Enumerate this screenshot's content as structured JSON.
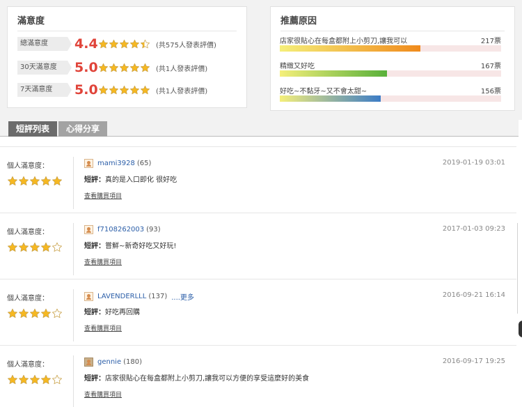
{
  "satisfaction": {
    "title": "滿意度",
    "rows": [
      {
        "label": "總滿意度",
        "score": "4.4",
        "rating": 4.4,
        "count": "(共575人發表評價)"
      },
      {
        "label": "30天滿意度",
        "score": "5.0",
        "rating": 5,
        "count": "(共1人發表評價)"
      },
      {
        "label": "7天滿意度",
        "score": "5.0",
        "rating": 5,
        "count": "(共1人發表評價)"
      }
    ]
  },
  "reasons": {
    "title": "推薦原因",
    "items": [
      {
        "text": "店家很貼心在每盒都附上小剪刀,讓我可以",
        "votes": "217票",
        "fill": 0.635,
        "color": "#f08a1c"
      },
      {
        "text": "精緻又好吃",
        "votes": "167票",
        "fill": 0.485,
        "color": "#58b03a"
      },
      {
        "text": "好吃~不黏牙~又不會太甜~",
        "votes": "156票",
        "fill": 0.455,
        "color": "#3c7cc6"
      }
    ]
  },
  "tabs": [
    {
      "label": "短評列表"
    },
    {
      "label": "心得分享"
    }
  ],
  "reviews": [
    {
      "label": "個人滿意度：",
      "rating": 5,
      "user": "mami3928",
      "level": "(65)",
      "more": "",
      "date": "2019-01-19 03:01",
      "prefix": "短評：",
      "text": "真的是入口即化 很好吃",
      "link": "查看購買項目",
      "avatar": "default"
    },
    {
      "label": "個人滿意度：",
      "rating": 4,
      "user": "f7108262003",
      "level": "(93)",
      "more": "",
      "date": "2017-01-03 09:23",
      "prefix": "短評：",
      "text": "嘗鮮~新奇好吃又好玩!",
      "link": "查看購買項目",
      "avatar": "default"
    },
    {
      "label": "個人滿意度：",
      "rating": 4,
      "user": "LAVENDERLLL",
      "level": "(137)",
      "more": "....更多",
      "date": "2016-09-21 16:14",
      "prefix": "短評：",
      "text": "好吃再回購",
      "link": "查看購買項目",
      "avatar": "default"
    },
    {
      "label": "個人滿意度：",
      "rating": 4,
      "user": "gennie",
      "level": "(180)",
      "more": "",
      "date": "2016-09-17 19:25",
      "prefix": "短評：",
      "text": "店家很貼心在每盒都附上小剪刀,讓我可以方便的享受這麼好的美食",
      "link": "查看購買項目",
      "avatar": "photo"
    }
  ],
  "colors": {
    "star": "#f6b821",
    "star_empty": "#ffffff",
    "star_stroke": "#c9a24a",
    "score": "#e0443a"
  }
}
